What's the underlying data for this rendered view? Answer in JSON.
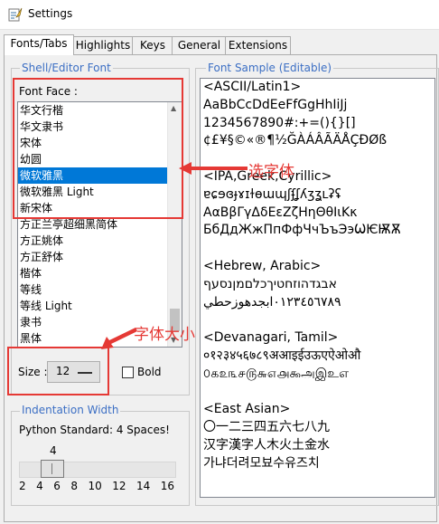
{
  "window": {
    "title": "Settings"
  },
  "tabs": [
    {
      "label": "Fonts/Tabs",
      "active": true
    },
    {
      "label": "Highlights",
      "active": false
    },
    {
      "label": "Keys",
      "active": false
    },
    {
      "label": "General",
      "active": false
    },
    {
      "label": "Extensions",
      "active": false
    }
  ],
  "shell_font": {
    "group_label": "Shell/Editor Font",
    "font_face_label": "Font Face :",
    "font_list": [
      "华文行楷",
      "华文隶书",
      "宋体",
      "幼圆",
      "微软雅黑",
      "微软雅黑 Light",
      "新宋体",
      "方正兰亭超细黑简体",
      "方正姚体",
      "方正舒体",
      "楷体",
      "等线",
      "等线 Light",
      "隶书",
      "黑体"
    ],
    "selected_font": "微软雅黑",
    "size_label": "Size :",
    "size_value": "12",
    "bold_label": "Bold",
    "bold_checked": false
  },
  "font_sample": {
    "label": "Font Sample (Editable)",
    "lines": [
      "<ASCII/Latin1>",
      "AaBbCcDdEeFfGgHhIiJj",
      "1234567890#:+=(){}[]",
      "¢£¥§©«®¶½ĞÀÁÂÃÄÅÇÐØß",
      "",
      "<IPA,Greek,Cyrillic>",
      "ɐɕɘɞɟɤɪɫɵɯɰʃʄʆʎʒʓʟʡʢ",
      "ΑαΒβΓγΔδΕεΖζΗηΘθΙιΚκ",
      "БбДдЖжПпФфЧчЪъЭэѠѤѬѪ",
      "",
      "<Hebrew, Arabic>",
      "אבגדהוזחטיךכלםמןנסעף",
      "٠١٢٣٤٥٦٧٨٩ابجدهوزحطي",
      "",
      "<Devanagari, Tamil>",
      "०१२३४५६७८९अआइईउऊएऐओऔ",
      "௦௧௨௩௪௫௬௭௮௯அஇஉஎ",
      "",
      "<East Asian>",
      "〇一二三四五六七八九",
      "汉字漢字人木火土金水",
      "가냐더려모뵤수유즈치"
    ]
  },
  "indentation": {
    "group_label": "Indentation Width",
    "standard_text": "Python Standard: 4 Spaces!",
    "value": 4,
    "value_label": "4",
    "ticks": [
      "2",
      "4",
      "6",
      "8",
      "10",
      "12",
      "14",
      "16"
    ]
  },
  "annotations": {
    "select_font": "选字体",
    "font_size": "字体大小"
  },
  "colors": {
    "selection": "#0078d7",
    "group_label": "#3c6fc4",
    "annotation": "#e53935"
  }
}
